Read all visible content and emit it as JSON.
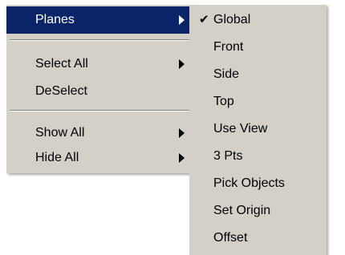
{
  "main_menu": {
    "items": [
      {
        "label": "Planes",
        "has_submenu": true,
        "active": true
      },
      {
        "label": "Select All",
        "has_submenu": true
      },
      {
        "label": "DeSelect",
        "has_submenu": false
      },
      {
        "label": "Show All",
        "has_submenu": true
      },
      {
        "label": "Hide All",
        "has_submenu": true
      }
    ]
  },
  "planes_submenu": {
    "items": [
      {
        "label": "Global",
        "checked": true
      },
      {
        "label": "Front"
      },
      {
        "label": "Side"
      },
      {
        "label": "Top"
      },
      {
        "label": "Use View"
      },
      {
        "label": "3 Pts"
      },
      {
        "label": "Pick Objects"
      },
      {
        "label": "Set Origin"
      },
      {
        "label": "Offset"
      }
    ],
    "check_glyph": "✔"
  },
  "colors": {
    "menu_background": "#d4d0c8",
    "highlight": "#0a246a",
    "highlight_text": "#ffffff"
  }
}
